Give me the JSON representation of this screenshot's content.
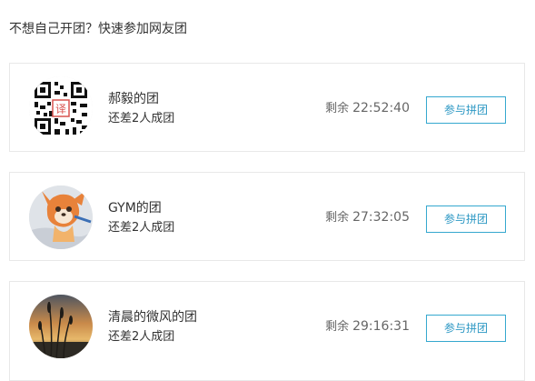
{
  "section": {
    "title": "不想自己开团？快速参加网友团"
  },
  "groups": [
    {
      "name": "郝毅的团",
      "needed": "还差2人成团",
      "countdown_label": "剩余",
      "countdown_time": "22:52:40",
      "button_label": "参与拼团",
      "avatar_text": "译"
    },
    {
      "name": "GYM的团",
      "needed": "还差2人成团",
      "countdown_label": "剩余",
      "countdown_time": "27:32:05",
      "button_label": "参与拼团"
    },
    {
      "name": "清晨的微风的团",
      "needed": "还差2人成团",
      "countdown_label": "剩余",
      "countdown_time": "29:16:31",
      "button_label": "参与拼团"
    }
  ],
  "colors": {
    "accent": "#35a8cf",
    "border": "#e8e8e8",
    "text": "#333333",
    "muted": "#666666"
  },
  "icons": {
    "avatar_1": "qr-code-avatar",
    "avatar_2": "cartoon-avatar",
    "avatar_3": "sunset-grass-avatar"
  }
}
